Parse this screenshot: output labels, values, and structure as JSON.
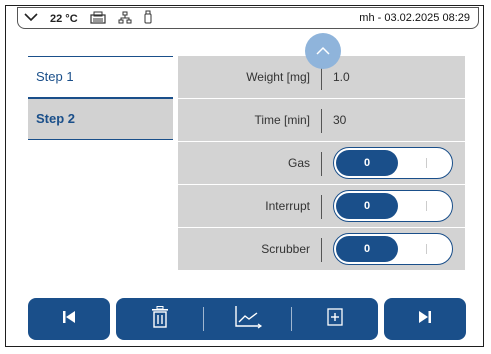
{
  "status": {
    "temperature": "22 °C",
    "right_text": "mh - 03.02.2025 08:29"
  },
  "steps": [
    {
      "label": "Step 1"
    },
    {
      "label": "Step 2"
    }
  ],
  "params": [
    {
      "label": "Weight [mg]",
      "value": "1.0"
    },
    {
      "label": "Time [min]",
      "value": "30"
    },
    {
      "label": "Gas",
      "toggle": "0"
    },
    {
      "label": "Interrupt",
      "toggle": "0"
    },
    {
      "label": "Scrubber",
      "toggle": "0"
    }
  ],
  "icons": {
    "status": [
      "chevron-down-icon",
      "printer-icon",
      "network-icon",
      "usb-icon"
    ],
    "scroll": "chevron-up-icon",
    "toolbar": [
      "skip-previous-icon",
      "trash-icon",
      "chart-icon",
      "add-icon",
      "skip-next-icon"
    ]
  },
  "colors": {
    "accent": "#1a4f8a",
    "panel": "#d3d3d3",
    "scroll_button": "#8fb4db"
  }
}
